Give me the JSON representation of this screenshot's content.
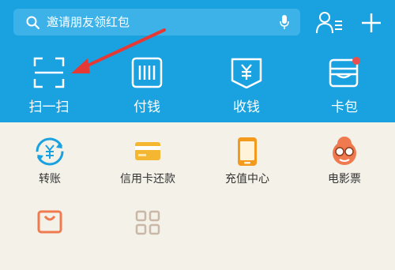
{
  "search": {
    "placeholder": "邀请朋友领红包"
  },
  "header": {
    "contacts_icon": "contacts-icon",
    "add_icon": "plus-icon"
  },
  "quick_actions": [
    {
      "label": "扫一扫",
      "icon": "scan-icon"
    },
    {
      "label": "付钱",
      "icon": "pay-barcode-icon"
    },
    {
      "label": "收钱",
      "icon": "receive-money-icon"
    },
    {
      "label": "卡包",
      "icon": "card-wallet-icon",
      "badge": true
    }
  ],
  "services": [
    {
      "label": "转账",
      "icon": "transfer-icon"
    },
    {
      "label": "信用卡还款",
      "icon": "credit-card-icon"
    },
    {
      "label": "充值中心",
      "icon": "phone-recharge-icon"
    },
    {
      "label": "电影票",
      "icon": "movie-ticket-icon"
    }
  ],
  "colors": {
    "header_bg": "#1aa1e0",
    "body_bg": "#f4f1e8",
    "annotation_arrow": "#e53935",
    "badge": "#e84f4f"
  }
}
